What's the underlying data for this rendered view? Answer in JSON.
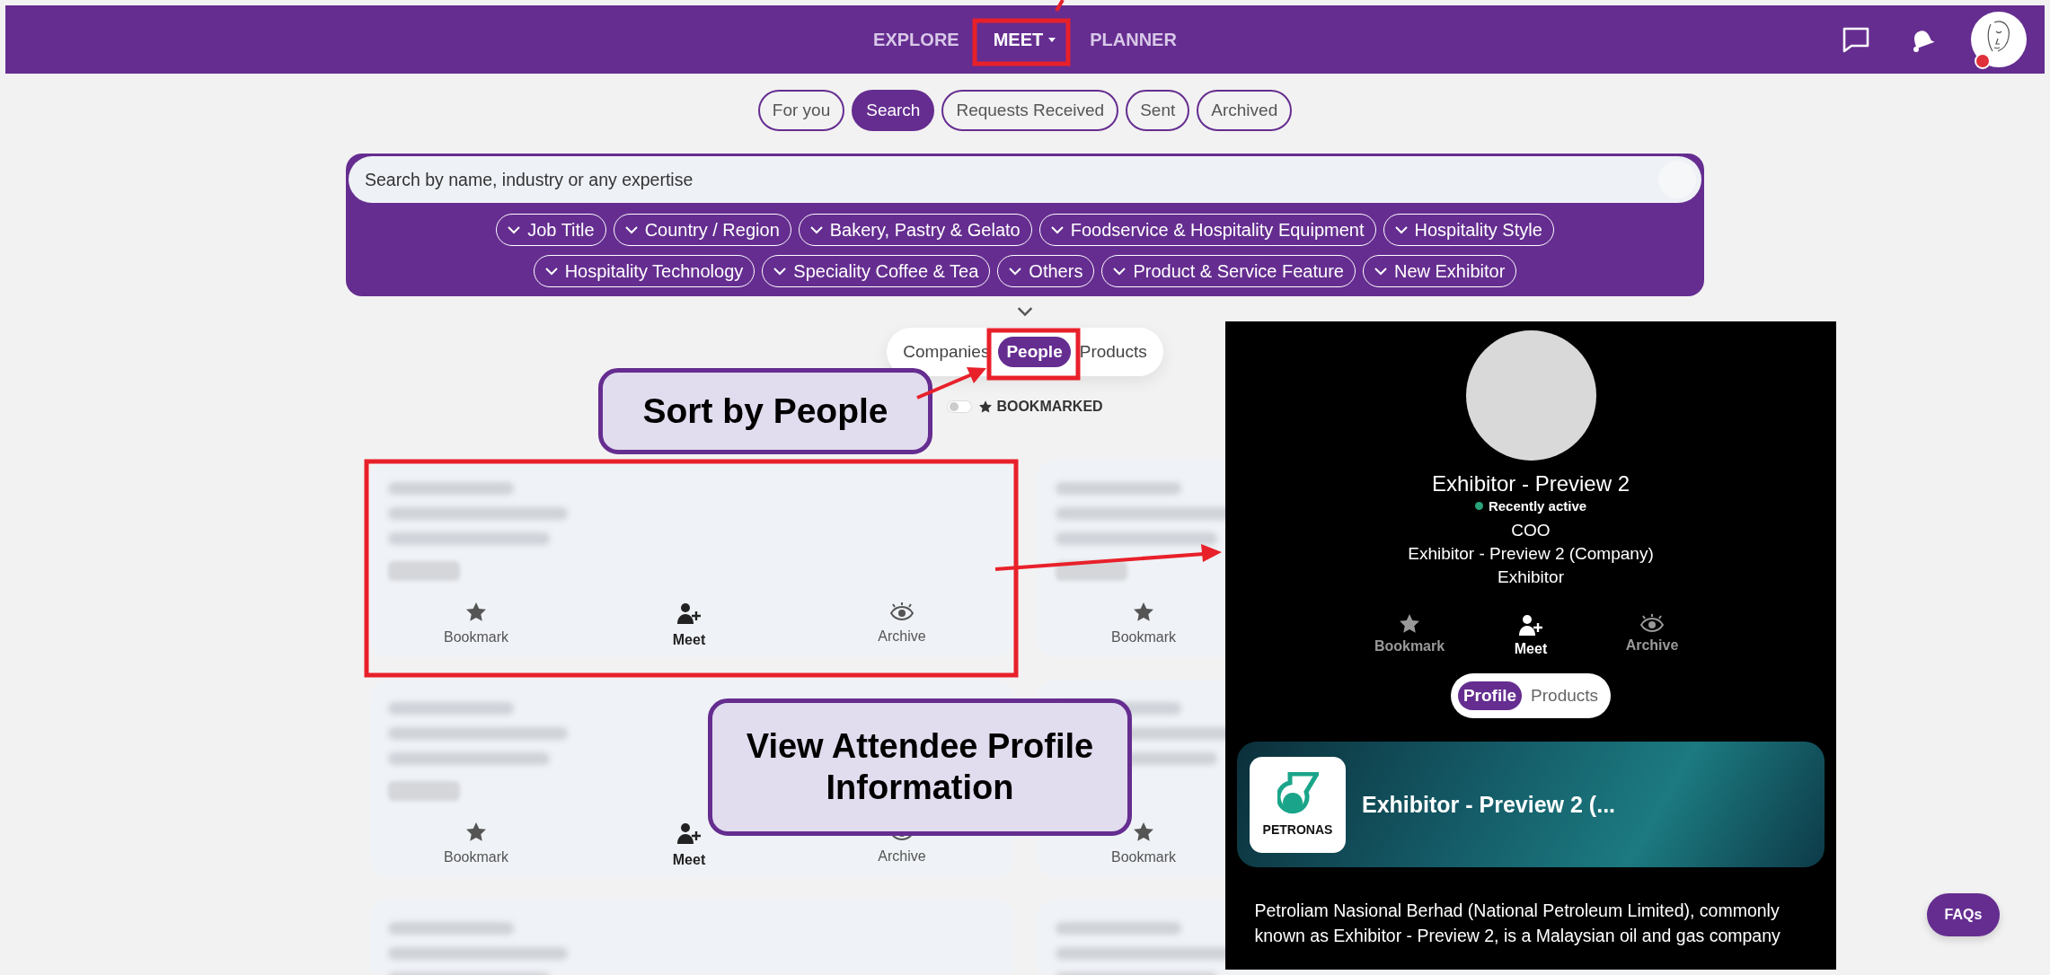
{
  "nav": {
    "items": [
      {
        "label": "EXPLORE",
        "selected": false,
        "dropdown": false
      },
      {
        "label": "MEET",
        "selected": true,
        "dropdown": true
      },
      {
        "label": "PLANNER",
        "selected": false,
        "dropdown": false
      }
    ]
  },
  "meet_tabs": [
    {
      "label": "For you",
      "selected": false
    },
    {
      "label": "Search",
      "selected": true
    },
    {
      "label": "Requests Received",
      "selected": false
    },
    {
      "label": "Sent",
      "selected": false
    },
    {
      "label": "Archived",
      "selected": false
    }
  ],
  "search": {
    "placeholder": "Search by name, industry or any expertise"
  },
  "filter_rows": [
    {
      "chips": [
        "Job Title",
        "Country / Region",
        "Bakery, Pastry & Gelato",
        "Foodservice & Hospitality Equipment",
        "Hospitality Style"
      ]
    },
    {
      "chips": [
        "Hospitality Technology",
        "Speciality Coffee & Tea",
        "Others",
        "Product & Service Feature",
        "New Exhibitor"
      ]
    }
  ],
  "result_types": [
    {
      "label": "Companies",
      "selected": false
    },
    {
      "label": "People",
      "selected": true
    },
    {
      "label": "Products",
      "selected": false
    }
  ],
  "bookmarked_filter": {
    "label": "BOOKMARKED",
    "on": false
  },
  "cards": [
    {
      "kind": "person",
      "actions": [
        {
          "kind": "bookmark",
          "label": "Bookmark"
        },
        {
          "kind": "meet",
          "label": "Meet"
        },
        {
          "kind": "archive",
          "label": "Archive"
        }
      ]
    },
    {
      "kind": "person",
      "actions": [
        {
          "kind": "bookmark",
          "label": "Bookmark"
        }
      ]
    },
    {
      "kind": "person",
      "actions": [
        {
          "kind": "bookmark",
          "label": "Bookmark"
        },
        {
          "kind": "meet",
          "label": "Meet"
        },
        {
          "kind": "archive",
          "label": "Archive"
        }
      ]
    },
    {
      "kind": "person",
      "actions": [
        {
          "kind": "bookmark",
          "label": "Bookmark"
        }
      ]
    },
    {
      "kind": "partial"
    },
    {
      "kind": "partial"
    }
  ],
  "profile": {
    "name": "Exhibitor - Preview 2",
    "status": "Recently active",
    "job_title": "COO",
    "company": "Exhibitor - Preview 2 (Company)",
    "role": "Exhibitor",
    "actions": [
      {
        "kind": "bookmark",
        "label": "Bookmark"
      },
      {
        "kind": "meet",
        "label": "Meet"
      },
      {
        "kind": "archive",
        "label": "Archive"
      }
    ],
    "tabs": [
      {
        "label": "Profile",
        "selected": true
      },
      {
        "label": "Products",
        "selected": false
      }
    ],
    "company_card": {
      "logo_text": "PETRONAS",
      "name": "Exhibitor - Preview 2 (..."
    },
    "description": "Petroliam Nasional Berhad (National Petroleum Limited), commonly known as Exhibitor - Preview 2, is a Malaysian oil and gas company"
  },
  "annotations": [
    {
      "text": "Sort by People"
    },
    {
      "text": "View Attendee Profile Information"
    }
  ],
  "faq_button": "FAQs"
}
